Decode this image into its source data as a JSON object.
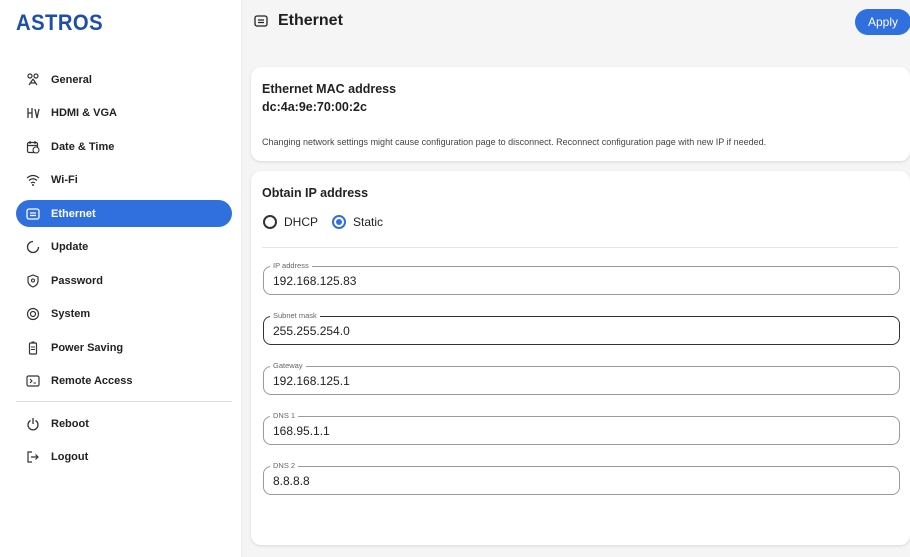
{
  "sidebar": {
    "logo": "ASTROS",
    "items": [
      {
        "label": "General",
        "icon": "people-icon"
      },
      {
        "label": "HDMI & VGA",
        "icon": "display-icon"
      },
      {
        "label": "Date & Time",
        "icon": "calendar-clock-icon"
      },
      {
        "label": "Wi-Fi",
        "icon": "wifi-icon"
      },
      {
        "label": "Ethernet",
        "icon": "ethernet-icon",
        "active": true
      },
      {
        "label": "Update",
        "icon": "update-icon"
      },
      {
        "label": "Password",
        "icon": "shield-lock-icon"
      },
      {
        "label": "System",
        "icon": "chip-icon"
      },
      {
        "label": "Power Saving",
        "icon": "battery-icon"
      },
      {
        "label": "Remote Access",
        "icon": "remote-icon"
      }
    ],
    "bottom_items": [
      {
        "label": "Reboot",
        "icon": "power-icon"
      },
      {
        "label": "Logout",
        "icon": "logout-icon"
      }
    ]
  },
  "header": {
    "title": "Ethernet",
    "icon": "ethernet-icon",
    "apply_label": "Apply"
  },
  "mac_card": {
    "title": "Ethernet MAC address",
    "mac": "dc:4a:9e:70:00:2c",
    "note": "Changing network settings might cause configuration page to disconnect. Reconnect configuration page with new IP if needed."
  },
  "ip_card": {
    "title": "Obtain IP address",
    "options": [
      {
        "label": "DHCP",
        "checked": false
      },
      {
        "label": "Static",
        "checked": true
      }
    ],
    "fields": [
      {
        "label": "IP address",
        "value": "192.168.125.83"
      },
      {
        "label": "Subnet mask",
        "value": "255.255.254.0"
      },
      {
        "label": "Gateway",
        "value": "192.168.125.1"
      },
      {
        "label": "DNS 1",
        "value": "168.95.1.1"
      },
      {
        "label": "DNS 2",
        "value": "8.8.8.8"
      }
    ]
  },
  "colors": {
    "accent": "#2f6fde",
    "logo": "#1d4fa8"
  }
}
